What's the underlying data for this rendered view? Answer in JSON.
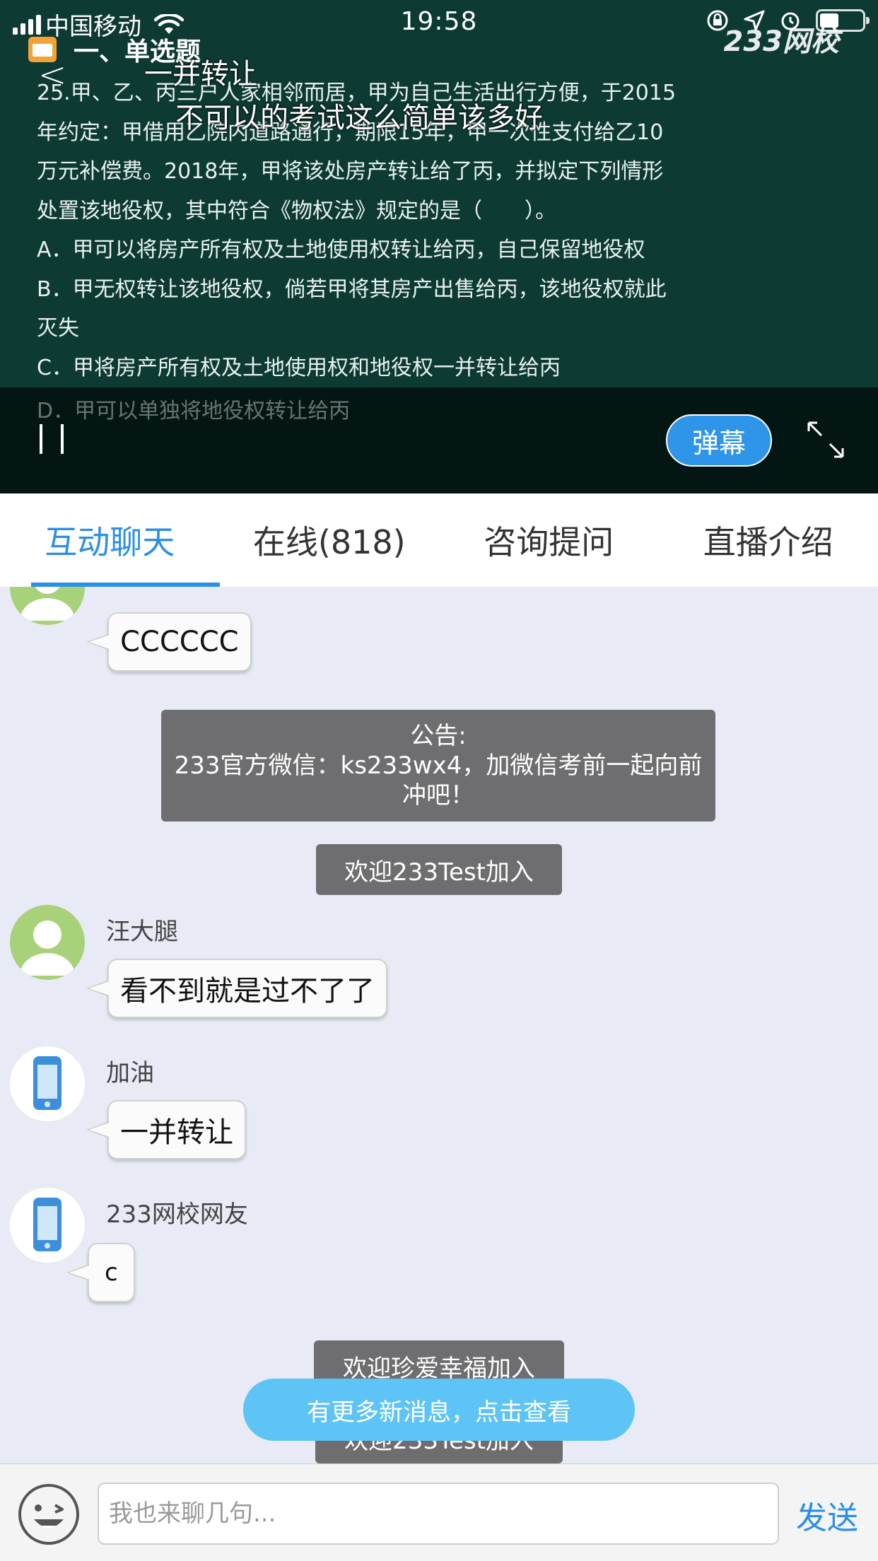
{
  "status_bar": {
    "carrier": "中国移动",
    "time": "19:58"
  },
  "video": {
    "watermark": "233网校",
    "slide_title": "一、单选题",
    "question_lines": [
      "25.甲、乙、丙三户人家相邻而居，甲为自己生活出行方便，于2015",
      "年约定：甲借用乙院内道路通行，期限15年，甲一次性支付给乙10",
      "万元补偿费。2018年，甲将该处房产转让给了丙，并拟定下列情形",
      "处置该地役权，其中符合《物权法》规定的是（　　）。",
      "A．甲可以将房产所有权及土地使用权转让给丙，自己保留地役权",
      "B．甲无权转让该地役权，倘若甲将其房产出售给丙，该地役权就此",
      "灭失",
      "C．甲将房产所有权及土地使用权和地役权一并转让给丙"
    ],
    "option_d": "D．甲可以单独将地役权转让给丙",
    "danmu": [
      "一并转让",
      "不可以的考试这么简单该多好"
    ],
    "danmu_button": "弹幕"
  },
  "tabs": [
    {
      "label": "互动聊天",
      "active": true
    },
    {
      "label": "在线(818)",
      "active": false
    },
    {
      "label": "咨询提问",
      "active": false
    },
    {
      "label": "直播介绍",
      "active": false
    }
  ],
  "chat": {
    "first_bubble": "CCCCCC",
    "notice": {
      "heading": "公告:",
      "body": "233官方微信：ks233wx4，加微信考前一起向前冲吧！"
    },
    "welcome_1": "欢迎233Test加入",
    "messages": [
      {
        "nick": "汪大腿",
        "text": "看不到就是过不了了",
        "avatar": "user-avatar-icon"
      },
      {
        "nick": "加油",
        "text": "一并转让",
        "avatar": "phone-avatar-icon"
      },
      {
        "nick": "233网校网友",
        "text": "c",
        "avatar": "phone-avatar-icon"
      }
    ],
    "welcome_2": "欢迎珍爱幸福加入",
    "welcome_3": "欢迎233Test加入",
    "new_messages": "有更多新消息，点击查看"
  },
  "input_bar": {
    "placeholder": "我也来聊几句...",
    "send": "发送"
  },
  "colors": {
    "accent": "#2b8fe4",
    "video_bg": "#0d3a33",
    "system_message": "#6e6e70",
    "new_message_pill": "#5ec3f5"
  }
}
